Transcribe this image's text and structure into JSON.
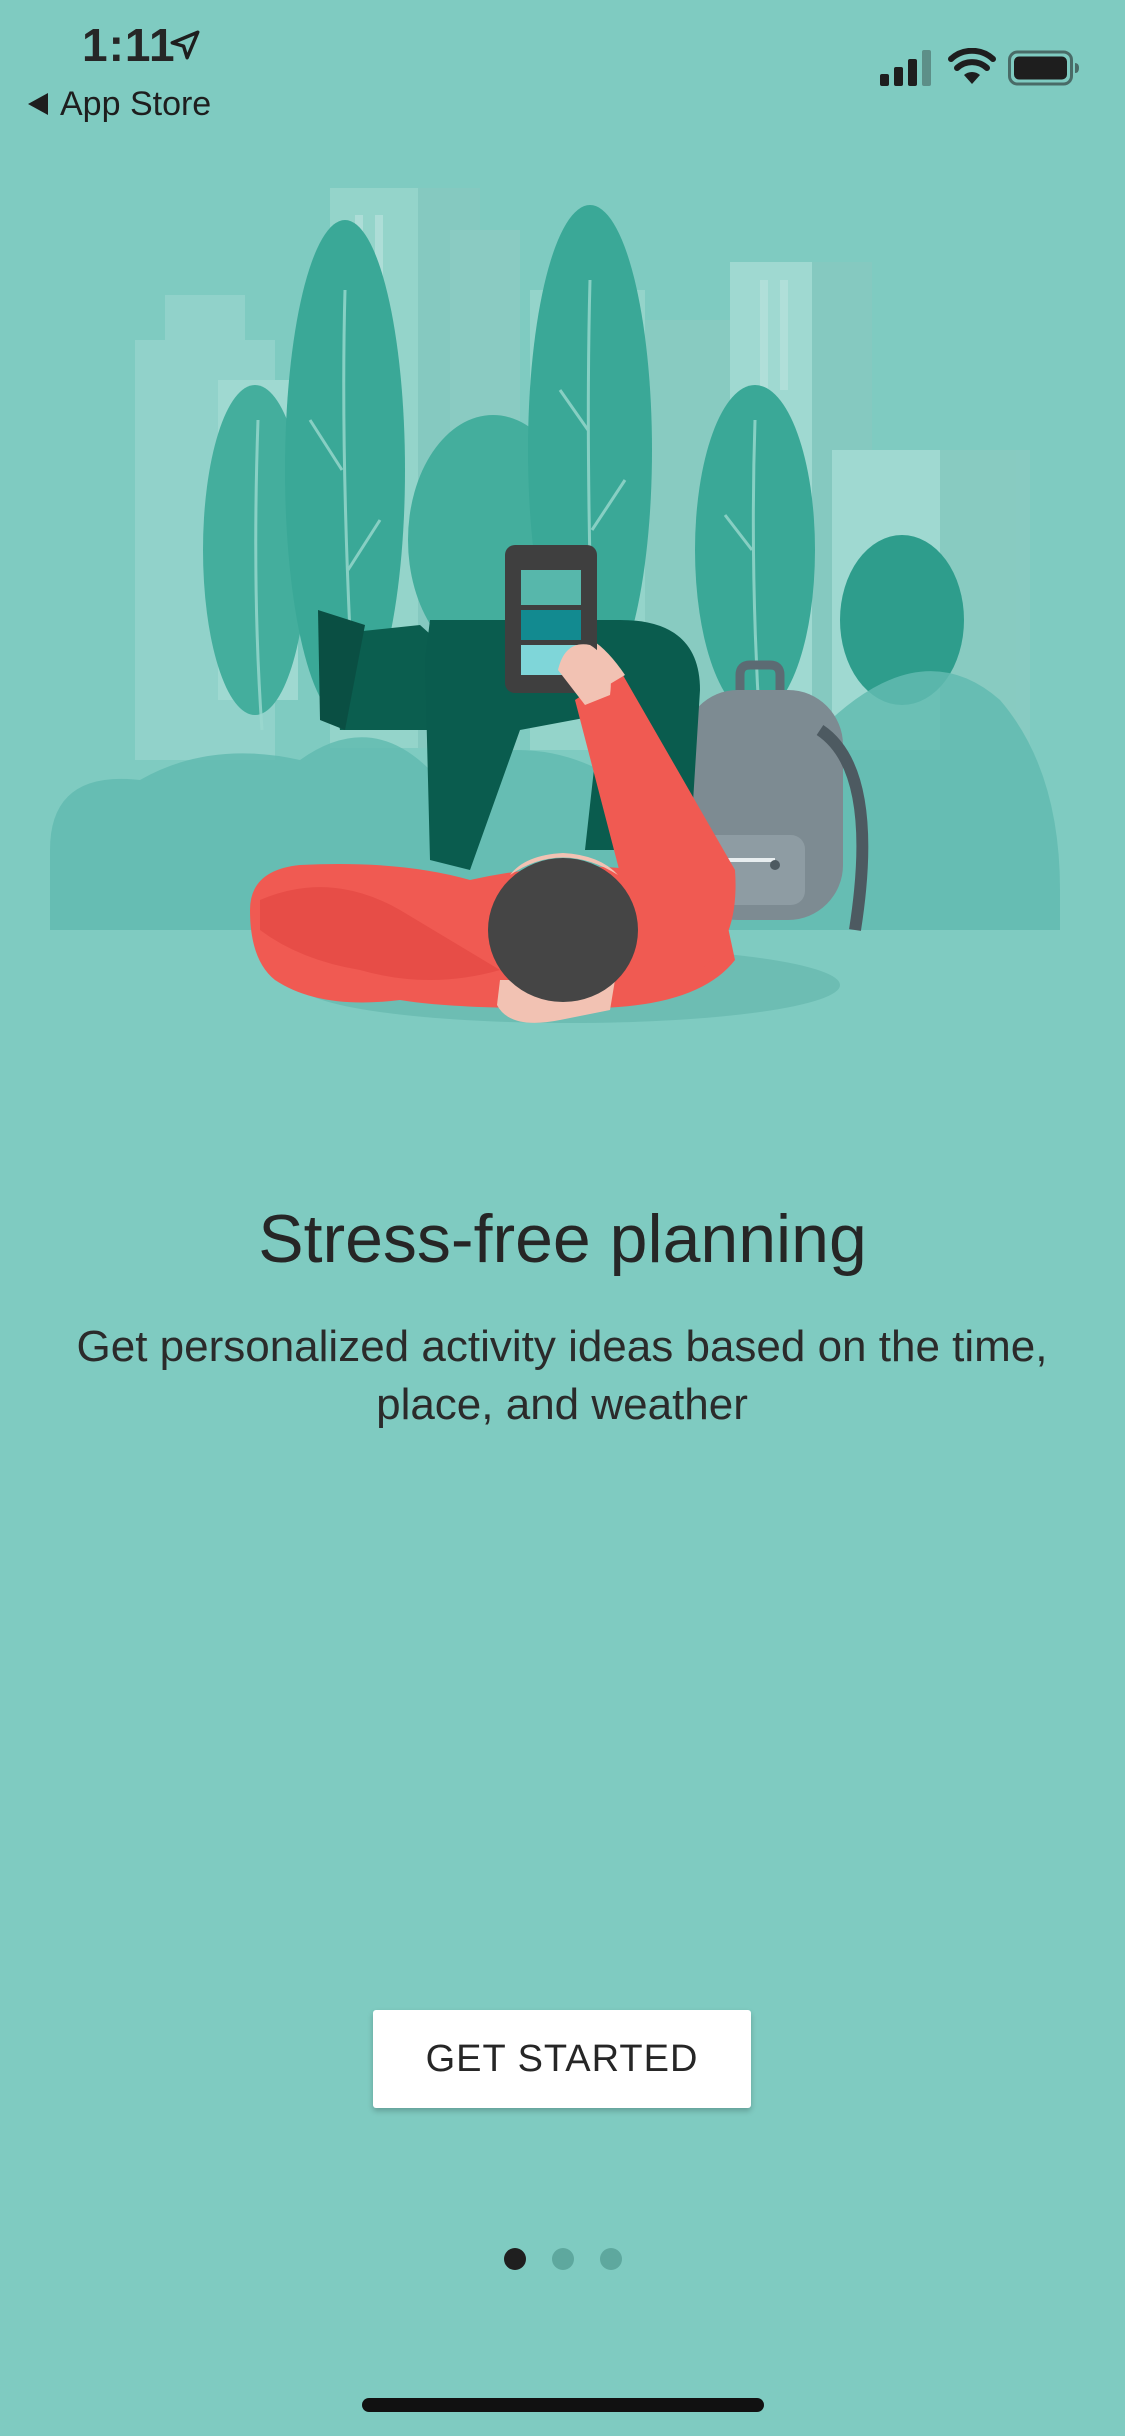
{
  "status_bar": {
    "time": "1:11",
    "back_label": "App Store"
  },
  "icons": [
    "location-arrow-icon",
    "back-arrow-icon",
    "cellular-signal-icon",
    "wifi-icon",
    "battery-icon"
  ],
  "onboarding": {
    "headline": "Stress-free planning",
    "description": "Get personalized activity ideas based on the time, place, and weather",
    "cta_label": "GET STARTED",
    "page_count": 3,
    "current_page": 1
  },
  "colors": {
    "background": "#7fcbc1",
    "text": "#262626",
    "button_background": "#ffffff",
    "dot_active": "#1f1f1f",
    "dot_inactive": "#5ea89e",
    "jacket": "#f05a52",
    "trees": "#3aa897"
  }
}
